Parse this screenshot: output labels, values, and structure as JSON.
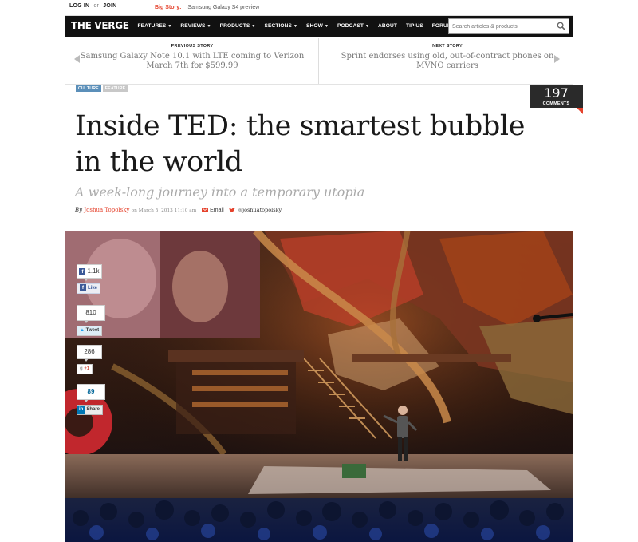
{
  "topbar": {
    "login": "LOG IN",
    "or": "or",
    "join": "JOIN",
    "big_story_label": "Big Story:",
    "big_story_text": "Samsung Galaxy S4 preview"
  },
  "nav": {
    "logo": "THE VERGE",
    "items": [
      "FEATURES",
      "REVIEWS",
      "PRODUCTS",
      "SECTIONS",
      "SHOW",
      "PODCAST",
      "ABOUT",
      "TIP US",
      "FORUMS"
    ],
    "search_placeholder": "Search articles & products"
  },
  "story_nav": {
    "prev_label": "PREVIOUS STORY",
    "prev_title": "Samsung Galaxy Note 10.1 with LTE coming to Verizon March 7th for $599.99",
    "next_label": "NEXT STORY",
    "next_title": "Sprint endorses using old, out-of-contract phones on MVNO carriers"
  },
  "tags": [
    "CULTURE",
    "FEATURE"
  ],
  "comments": {
    "count": "197",
    "label": "COMMENTS"
  },
  "article": {
    "title": "Inside TED: the smartest bubble in the world",
    "dek": "A week-long journey into a temporary utopia",
    "by": "By",
    "author": "Joshua Topolsky",
    "date": "on March 5, 2013 11:10 am",
    "email": "Email",
    "twitter": "@joshuatopolsky"
  },
  "share": {
    "facebook_count": "1.1k",
    "facebook_label": "Like",
    "twitter_count": "810",
    "twitter_label": "Tweet",
    "google_count": "286",
    "google_label": "+1",
    "linkedin_count": "89",
    "linkedin_label": "Share"
  },
  "colors": {
    "accent": "#e5422c",
    "nav_bg": "#111111",
    "tag_culture": "#5b8fb9"
  },
  "icons": [
    "search-icon",
    "chevron-left-icon",
    "chevron-right-icon",
    "email-icon",
    "twitter-icon"
  ]
}
